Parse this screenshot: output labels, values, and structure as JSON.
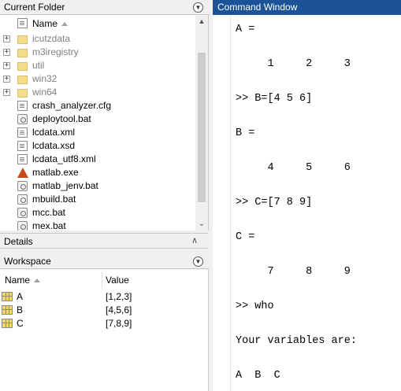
{
  "current_folder": {
    "title": "Current Folder",
    "column_header": "Name",
    "items": [
      {
        "name": "icutzdata",
        "type": "folder"
      },
      {
        "name": "m3iregistry",
        "type": "folder"
      },
      {
        "name": "util",
        "type": "folder"
      },
      {
        "name": "win32",
        "type": "folder"
      },
      {
        "name": "win64",
        "type": "folder"
      },
      {
        "name": "crash_analyzer.cfg",
        "type": "file"
      },
      {
        "name": "deploytool.bat",
        "type": "bat"
      },
      {
        "name": "lcdata.xml",
        "type": "file"
      },
      {
        "name": "lcdata.xsd",
        "type": "file"
      },
      {
        "name": "lcdata_utf8.xml",
        "type": "file"
      },
      {
        "name": "matlab.exe",
        "type": "matlab"
      },
      {
        "name": "matlab_jenv.bat",
        "type": "bat"
      },
      {
        "name": "mbuild.bat",
        "type": "bat"
      },
      {
        "name": "mcc.bat",
        "type": "bat"
      },
      {
        "name": "mex.bat",
        "type": "bat"
      }
    ]
  },
  "details": {
    "title": "Details"
  },
  "workspace": {
    "title": "Workspace",
    "columns": {
      "name": "Name",
      "value": "Value"
    },
    "rows": [
      {
        "name": "A",
        "value": "[1,2,3]"
      },
      {
        "name": "B",
        "value": "[4,5,6]"
      },
      {
        "name": "C",
        "value": "[7,8,9]"
      }
    ]
  },
  "command_window": {
    "title": "Command Window",
    "lines": [
      "A =",
      "",
      "     1     2     3",
      "",
      ">> B=[4 5 6]",
      "",
      "B =",
      "",
      "     4     5     6",
      "",
      ">> C=[7 8 9]",
      "",
      "C =",
      "",
      "     7     8     9",
      "",
      ">> who",
      "",
      "Your variables are:",
      "",
      "A  B  C"
    ]
  },
  "colors": {
    "command_title_bg": "#1c5396",
    "folder_icon": "#f5dd8e",
    "variable_icon": "#f5d66b"
  }
}
